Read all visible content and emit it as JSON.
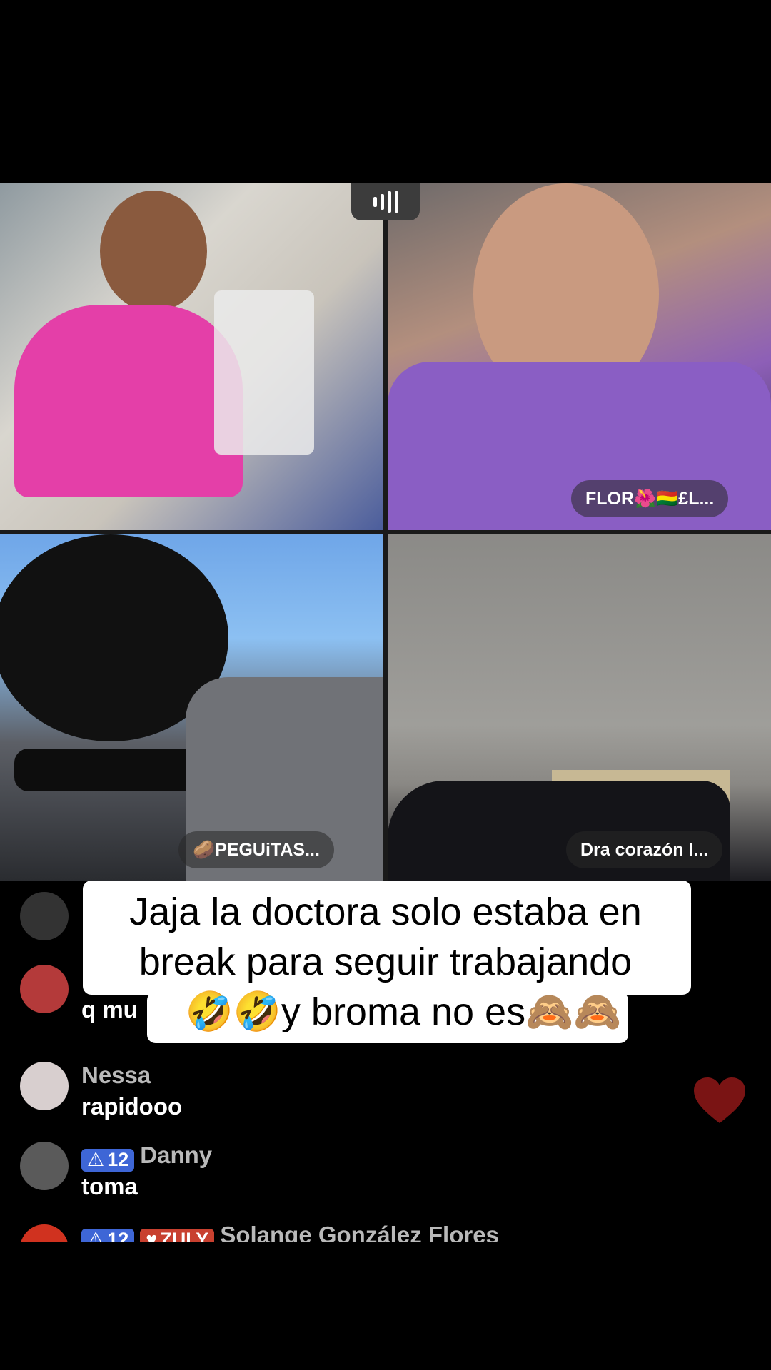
{
  "tiles": [
    {
      "name_label": ""
    },
    {
      "name_label": "FLOR🌺🇧🇴£L..."
    },
    {
      "name_label": "🥔PEGUiTAS..."
    },
    {
      "name_label": "Dra corazón l..."
    }
  ],
  "caption": {
    "line1": "Jaja la doctora solo estaba en",
    "line2": "break para seguir trabajando",
    "line3": "🤣🤣y broma no es🙈🙈"
  },
  "chat": {
    "messages": [
      {
        "user": "",
        "text": ""
      },
      {
        "user": "",
        "text": "q mu"
      },
      {
        "user": "Nessa",
        "text": "rapidooo"
      },
      {
        "user": "Danny",
        "badge_level": "12",
        "text": "toma"
      },
      {
        "user": "Solange  González Flores",
        "badge_level": "12",
        "fan_badge": "ZULY",
        "text": ""
      }
    ]
  },
  "colors": {
    "background": "#000000",
    "badge_blue": "#3e66d6",
    "badge_red": "#c8402f",
    "heart": "#7a1414"
  },
  "icons": [
    "audio-level-icon",
    "heart-icon",
    "level-badge-icon"
  ]
}
